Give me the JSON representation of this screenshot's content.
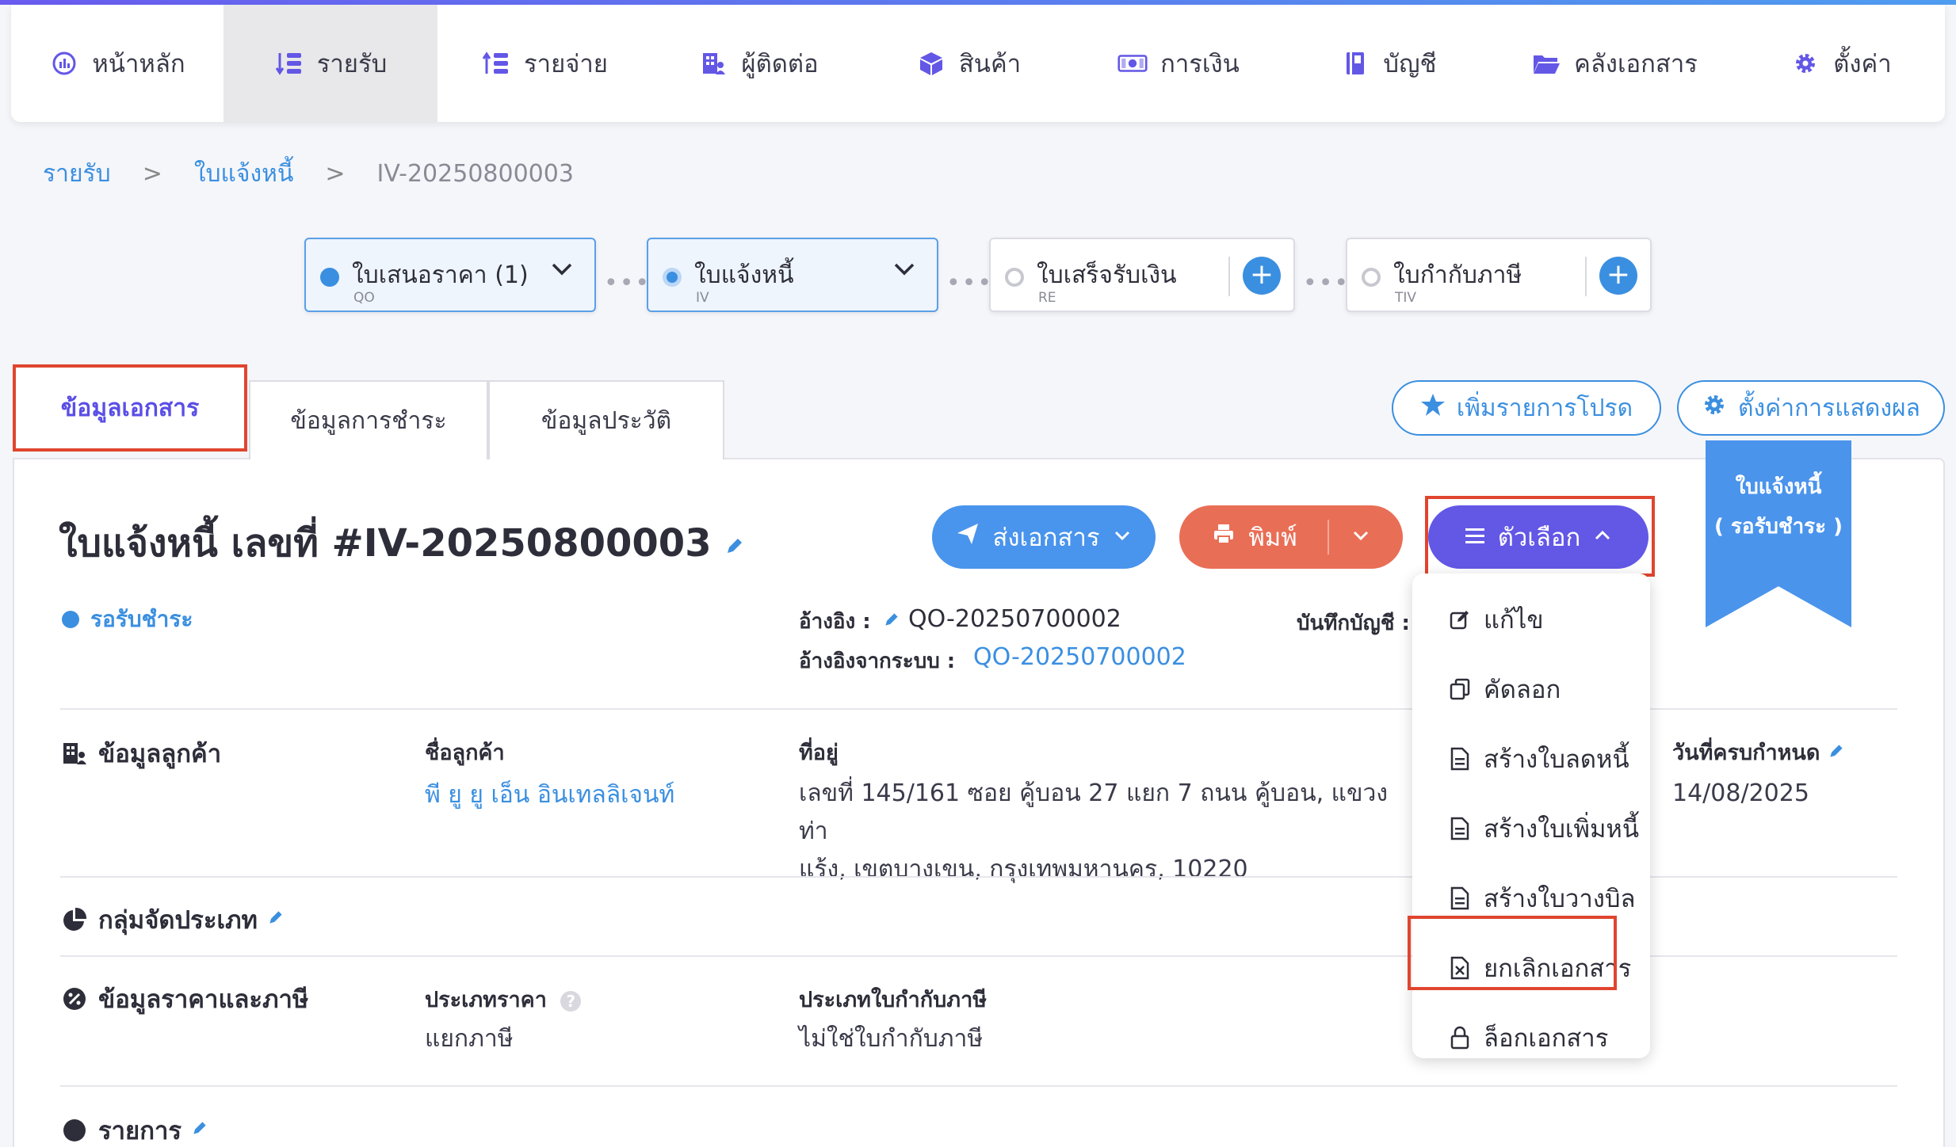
{
  "nav": {
    "items": [
      {
        "label": "หน้าหลัก",
        "icon": "dashboard-icon"
      },
      {
        "label": "รายรับ",
        "icon": "income-icon",
        "active": true
      },
      {
        "label": "รายจ่าย",
        "icon": "expense-icon"
      },
      {
        "label": "ผู้ติดต่อ",
        "icon": "contacts-icon"
      },
      {
        "label": "สินค้า",
        "icon": "product-box-icon"
      },
      {
        "label": "การเงิน",
        "icon": "money-icon"
      },
      {
        "label": "บัญชี",
        "icon": "accounting-book-icon"
      },
      {
        "label": "คลังเอกสาร",
        "icon": "folder-icon"
      },
      {
        "label": "ตั้งค่า",
        "icon": "gear-icon"
      }
    ]
  },
  "breadcrumb": {
    "level1": "รายรับ",
    "level2": "ใบแจ้งหนี้",
    "current": "IV-20250800003",
    "separator": ">"
  },
  "flow": {
    "quotation": {
      "title": "ใบเสนอราคา (1)",
      "code": "QO"
    },
    "invoice": {
      "title": "ใบแจ้งหนี้",
      "code": "IV"
    },
    "receipt": {
      "title": "ใบเสร็จรับเงิน",
      "code": "RE"
    },
    "tax_invoice": {
      "title": "ใบกำกับภาษี",
      "code": "TIV"
    },
    "connector": "•••",
    "plus": "+"
  },
  "tabs": {
    "doc_info": "ข้อมูลเอกสาร",
    "payment_info": "ข้อมูลการชำระ",
    "history": "ข้อมูลประวัติ"
  },
  "actions": {
    "add_favorite": "เพิ่มรายการโปรด",
    "display_settings": "ตั้งค่าการแสดงผล"
  },
  "ribbon": {
    "line1": "ใบแจ้งหนี้",
    "line2": "( รอรับชำระ )"
  },
  "document": {
    "title": "ใบแจ้งหนี้ เลขที่ #IV-20250800003",
    "status": "รอรับชำระ",
    "send_button": "ส่งเอกสาร",
    "print_button": "พิมพ์",
    "options_button": "ตัวเลือก",
    "reference_label": "อ้างอิง :",
    "reference_value": "QO-20250700002",
    "system_reference_label": "อ้างอิงจากระบบ :",
    "system_reference_value": "QO-20250700002",
    "accounting_label": "บันทึกบัญชี :"
  },
  "customer": {
    "section_title": "ข้อมูลลูกค้า",
    "name_label": "ชื่อลูกค้า",
    "name_value": "พี ยู ยู เอ็น อินเทลลิเจนท์",
    "address_label": "ที่อยู่",
    "address_line1": "เลขที่ 145/161 ซอย คู้บอน 27 แยก 7 ถนน คู้บอน, แขวงท่า",
    "address_line2": "แร้ง, เขตบางเขน, กรุงเทพมหานคร, 10220",
    "due_date_label": "วันที่ครบกำหนด",
    "due_date_value": "14/08/2025"
  },
  "classification": {
    "section_title": "กลุ่มจัดประเภท"
  },
  "pricing": {
    "section_title": "ข้อมูลราคาและภาษี",
    "price_type_label": "ประเภทราคา",
    "price_type_value": "แยกภาษี",
    "tax_invoice_type_label": "ประเภทใบกำกับภาษี",
    "tax_invoice_type_value": "ไม่ใช่ใบกำกับภาษี"
  },
  "items_section": {
    "section_title": "รายการ"
  },
  "options_menu": [
    {
      "label": "แก้ไข",
      "icon": "edit-icon"
    },
    {
      "label": "คัดลอก",
      "icon": "copy-icon"
    },
    {
      "label": "สร้างใบลดหนี้",
      "icon": "document-icon"
    },
    {
      "label": "สร้างใบเพิ่มหนี้",
      "icon": "document-icon"
    },
    {
      "label": "สร้างใบวางบิล",
      "icon": "document-icon"
    },
    {
      "label": "ยกเลิกเอกสาร",
      "icon": "cancel-document-icon"
    },
    {
      "label": "ล็อกเอกสาร",
      "icon": "lock-icon"
    }
  ],
  "colors": {
    "primary": "#6357e6",
    "blue": "#3b8fe0",
    "print": "#e96e56",
    "highlight": "#e0452f"
  }
}
